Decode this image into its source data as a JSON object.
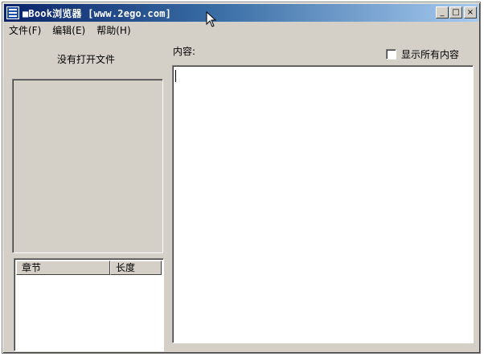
{
  "window": {
    "title": "■Book浏览器 [www.2ego.com]",
    "buttons": {
      "minimize": "_",
      "maximize": "□",
      "close": "×"
    }
  },
  "menu": [
    {
      "label": "文件(F)"
    },
    {
      "label": "编辑(E)"
    },
    {
      "label": "帮助(H)"
    }
  ],
  "left_panel": {
    "status": "没有打开文件",
    "chapter_list": {
      "columns": [
        "章节",
        "长度"
      ],
      "rows": []
    }
  },
  "right_panel": {
    "content_label": "内容:",
    "show_all_label": "显示所有内容",
    "show_all_checked": false,
    "content_text": ""
  },
  "colors": {
    "window_bg": "#d4d0c8",
    "title_start": "#0a246a",
    "title_end": "#a6caf0"
  }
}
